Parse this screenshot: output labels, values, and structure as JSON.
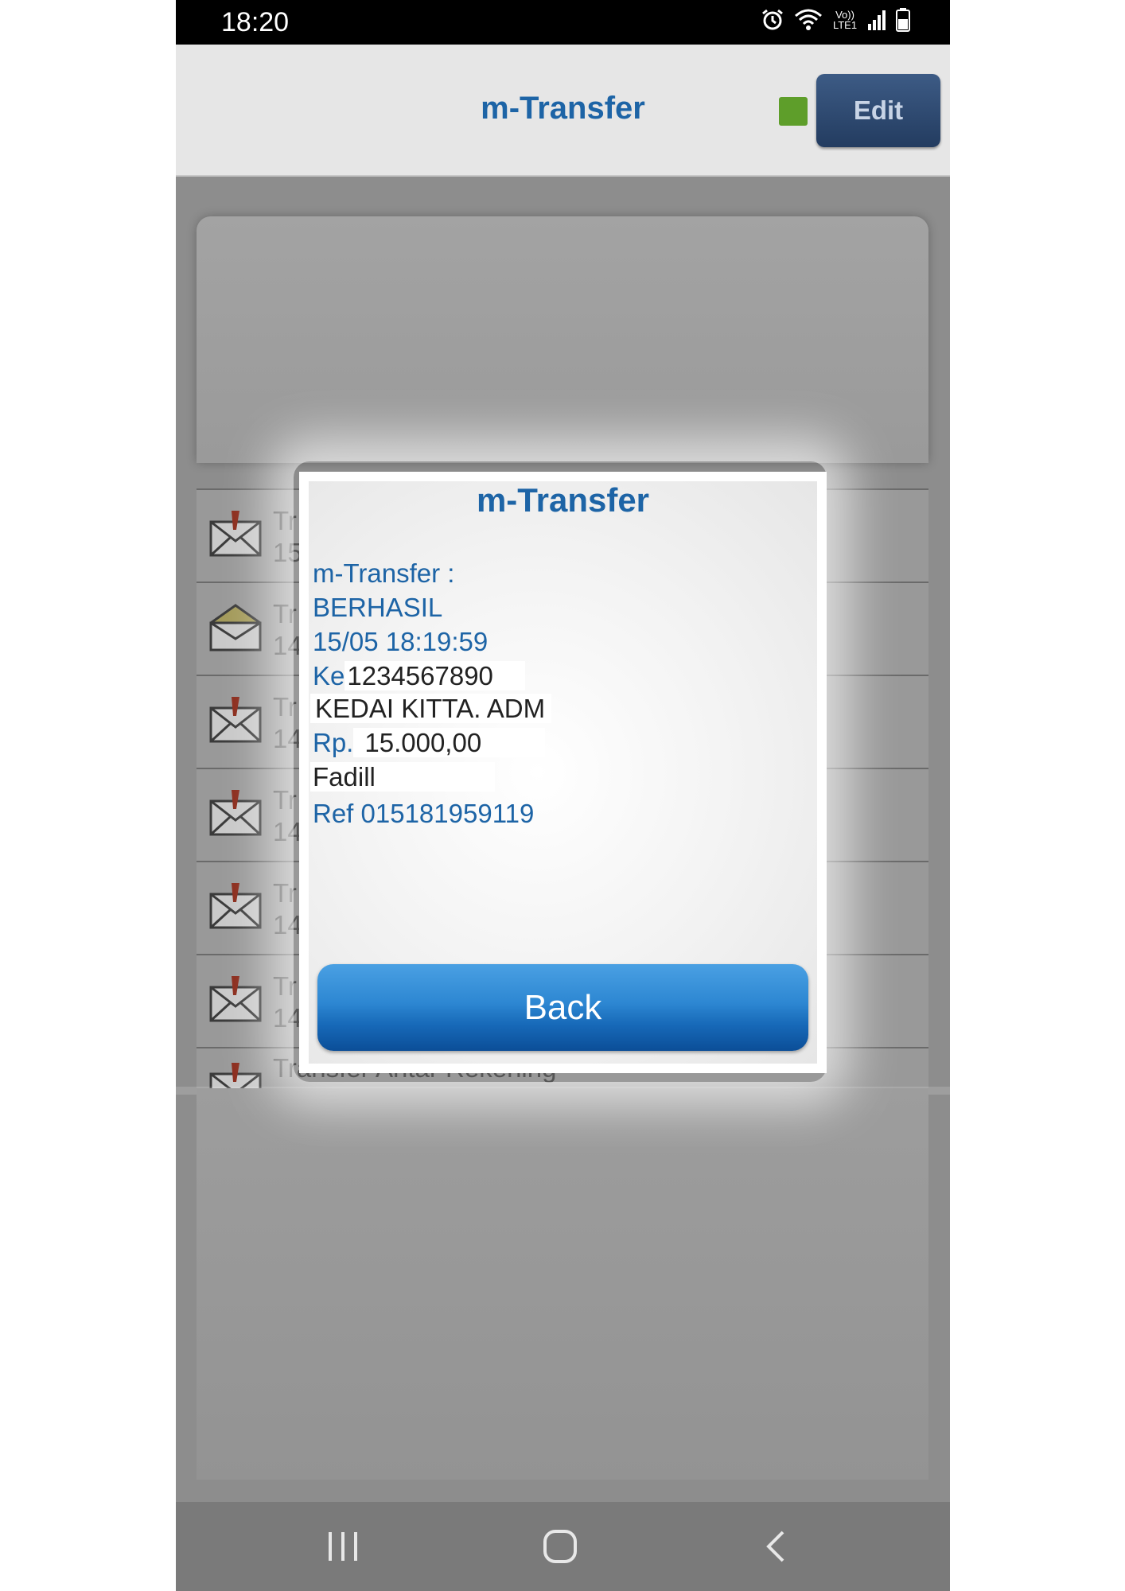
{
  "status_bar": {
    "time": "18:20",
    "network_label": "Vo)) LTE1"
  },
  "header": {
    "title": "m-Transfer",
    "edit_label": "Edit"
  },
  "background_list": {
    "rows": [
      {
        "title": "Tr",
        "subtitle": "15"
      },
      {
        "title": "Tr",
        "subtitle": "14"
      },
      {
        "title": "Tr",
        "subtitle": "14"
      },
      {
        "title": "Tr",
        "subtitle": "14"
      },
      {
        "title": "Tr",
        "subtitle": "14"
      },
      {
        "title": "Tr",
        "subtitle": "14"
      }
    ],
    "last_row_title": "Transfer Antar Rekening"
  },
  "dialog": {
    "title": "m-Transfer",
    "label": "m-Transfer :",
    "status": "BERHASIL",
    "datetime": "15/05 18:19:59",
    "to_label": "Ke",
    "to_account": "1234567890",
    "recipient": "KEDAI KITTA. ADM",
    "amount_label": "Rp.",
    "amount": "15.000,00",
    "note": "Fadill",
    "reference": "Ref 015181959119",
    "back_label": "Back"
  },
  "colors": {
    "accent": "#1d64a6",
    "button": "#1769b8",
    "indicator": "#5e9e2a"
  }
}
